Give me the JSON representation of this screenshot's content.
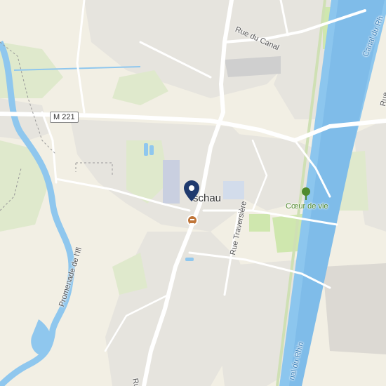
{
  "map": {
    "colors": {
      "background": "#f2efe4",
      "residential": "#e4e3dd",
      "green": "#dde9c8",
      "park": "#c9e6a4",
      "water": "#8fc7ee",
      "road": "#ffffff",
      "canal": "#7fc0ee",
      "pin": "#1f3a6e",
      "food_poi": "#c0763a",
      "park_poi": "#4f8a2e"
    },
    "labels": {
      "rue_du_canal": "Rue du Canal",
      "canal_top": "Canal du Rh",
      "canal_bottom": "nal du Rhin",
      "m221": "M 221",
      "town": "schau",
      "coeur_de_vie": "Cœur de vie",
      "rue_traversiere": "Rue Traversière",
      "promenade": "Promenade de l'Ill",
      "rue_fragment_right": "Rue",
      "rue_fragment_bottom": "Ru"
    },
    "icons": {
      "location_pin": "map-pin-icon",
      "restaurant": "restaurant-icon",
      "park": "tree-icon"
    }
  }
}
